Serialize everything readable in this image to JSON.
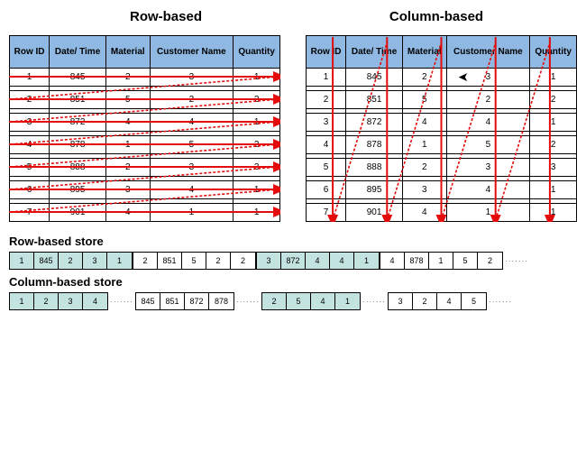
{
  "titles": {
    "left": "Row-based",
    "right": "Column-based"
  },
  "headers": [
    "Row ID",
    "Date/ Time",
    "Material",
    "Customer Name",
    "Quantity"
  ],
  "rows": [
    {
      "id": "1",
      "date": "845",
      "mat": "2",
      "cust": "3",
      "qty": "1"
    },
    {
      "id": "2",
      "date": "851",
      "mat": "5",
      "cust": "2",
      "qty": "2"
    },
    {
      "id": "3",
      "date": "872",
      "mat": "4",
      "cust": "4",
      "qty": "1"
    },
    {
      "id": "4",
      "date": "878",
      "mat": "1",
      "cust": "5",
      "qty": "2"
    },
    {
      "id": "5",
      "date": "888",
      "mat": "2",
      "cust": "3",
      "qty": "3"
    },
    {
      "id": "6",
      "date": "895",
      "mat": "3",
      "cust": "4",
      "qty": "1"
    },
    {
      "id": "7",
      "date": "901",
      "mat": "4",
      "cust": "1",
      "qty": "1"
    }
  ],
  "section_labels": {
    "row": "Row-based store",
    "col": "Column-based store"
  },
  "row_store": {
    "g1": [
      "1",
      "845",
      "2",
      "3",
      "1"
    ],
    "g2": [
      "2",
      "851",
      "5",
      "2",
      "2"
    ],
    "g3": [
      "3",
      "872",
      "4",
      "4",
      "1"
    ],
    "g4": [
      "4",
      "878",
      "1",
      "5",
      "2"
    ]
  },
  "col_store": {
    "g1": [
      "1",
      "2",
      "3",
      "4"
    ],
    "g2": [
      "845",
      "851",
      "872",
      "878"
    ],
    "g3": [
      "2",
      "5",
      "4",
      "1"
    ],
    "g4": [
      "3",
      "2",
      "4",
      "5"
    ]
  },
  "cursor_glyph": "➤"
}
